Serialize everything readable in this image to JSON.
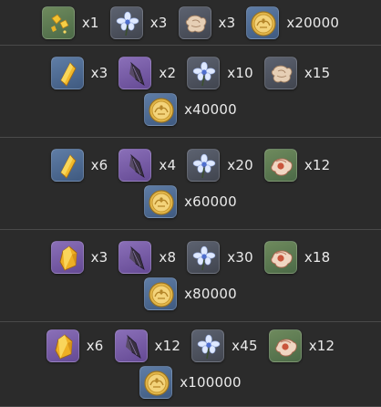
{
  "tiers": [
    {
      "lines": [
        [
          {
            "icon": "gem-shards-icon",
            "qty": "x1"
          },
          {
            "icon": "blue-flower-icon",
            "qty": "x3"
          },
          {
            "icon": "scroll-icon",
            "qty": "x3"
          },
          {
            "icon": "mora-coin-icon",
            "qty": "x20000"
          }
        ]
      ]
    },
    {
      "lines": [
        [
          {
            "icon": "gem-fragment-icon",
            "qty": "x3"
          },
          {
            "icon": "shard-icon",
            "qty": "x2"
          },
          {
            "icon": "blue-flower-icon",
            "qty": "x10"
          },
          {
            "icon": "scroll-icon",
            "qty": "x15"
          }
        ],
        [
          {
            "icon": "mora-coin-icon",
            "qty": "x40000"
          }
        ]
      ]
    },
    {
      "lines": [
        [
          {
            "icon": "gem-fragment-icon",
            "qty": "x6"
          },
          {
            "icon": "shard-icon",
            "qty": "x4"
          },
          {
            "icon": "blue-flower-icon",
            "qty": "x20"
          },
          {
            "icon": "silk-icon",
            "qty": "x12"
          }
        ],
        [
          {
            "icon": "mora-coin-icon",
            "qty": "x60000"
          }
        ]
      ]
    },
    {
      "lines": [
        [
          {
            "icon": "gem-chunk-icon",
            "qty": "x3"
          },
          {
            "icon": "shard-icon",
            "qty": "x8"
          },
          {
            "icon": "blue-flower-icon",
            "qty": "x30"
          },
          {
            "icon": "silk-icon",
            "qty": "x18"
          }
        ],
        [
          {
            "icon": "mora-coin-icon",
            "qty": "x80000"
          }
        ]
      ]
    },
    {
      "lines": [
        [
          {
            "icon": "gem-chunk-icon",
            "qty": "x6"
          },
          {
            "icon": "shard-icon",
            "qty": "x12"
          },
          {
            "icon": "blue-flower-icon",
            "qty": "x45"
          },
          {
            "icon": "silk-icon",
            "qty": "x12"
          }
        ],
        [
          {
            "icon": "mora-coin-icon",
            "qty": "x100000"
          }
        ]
      ]
    }
  ],
  "colors": {
    "background": "#2b2b2b",
    "divider": "#4a4a4a",
    "text": "#eaeaea"
  }
}
